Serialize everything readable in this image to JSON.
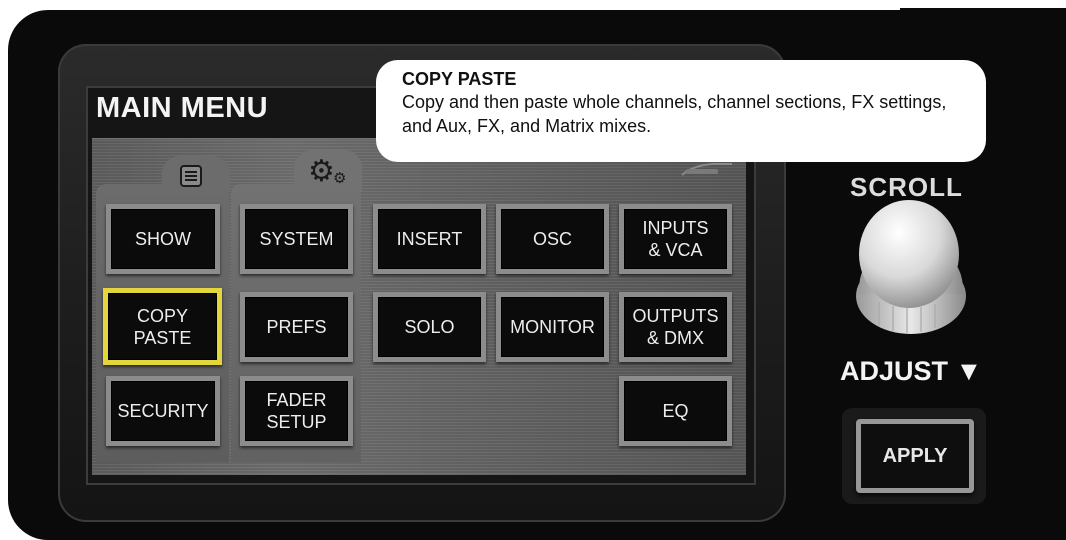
{
  "menu": {
    "title": "MAIN MENU"
  },
  "tooltip": {
    "title": "COPY PASTE",
    "body": "Copy and then paste whole channels, channel sections, FX settings, and Aux, FX, and Matrix mixes."
  },
  "icons": {
    "show_tab": "list-icon",
    "system_tab": "gears-icon",
    "scroll_area": "scroll-indicator-icon"
  },
  "buttons": {
    "show": "SHOW",
    "copy_paste": "COPY\nPASTE",
    "security": "SECURITY",
    "system": "SYSTEM",
    "prefs": "PREFS",
    "fader_setup": "FADER\nSETUP",
    "insert": "INSERT",
    "osc": "OSC",
    "inputs_vca": "INPUTS\n& VCA",
    "solo": "SOLO",
    "monitor": "MONITOR",
    "outputs_dmx": "OUTPUTS\n& DMX",
    "eq": "EQ"
  },
  "selected_button": "copy_paste",
  "controls": {
    "scroll_label": "SCROLL",
    "adjust_label": "ADJUST ▼",
    "apply_label": "APPLY"
  },
  "colors": {
    "selection": "#e3d63c"
  }
}
